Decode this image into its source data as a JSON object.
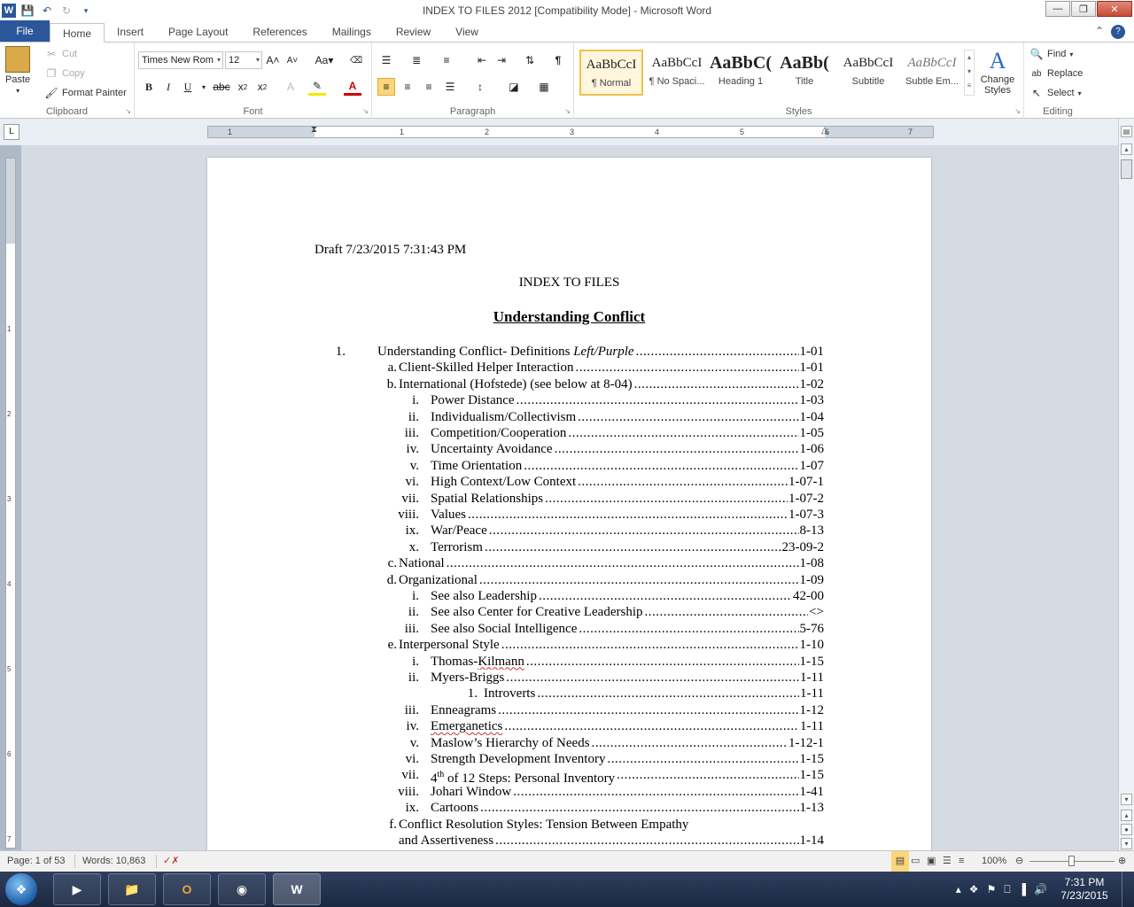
{
  "window": {
    "title": "INDEX TO FILES 2012 [Compatibility Mode]  -  Microsoft Word",
    "app_icon": "W",
    "minimize": "—",
    "maximize": "❐",
    "close": "✕"
  },
  "ribbon_tabs": [
    {
      "label": "File",
      "file": true
    },
    {
      "label": "Home",
      "active": true
    },
    {
      "label": "Insert"
    },
    {
      "label": "Page Layout"
    },
    {
      "label": "References"
    },
    {
      "label": "Mailings"
    },
    {
      "label": "Review"
    },
    {
      "label": "View"
    }
  ],
  "clipboard": {
    "paste": "Paste",
    "cut": "Cut",
    "copy": "Copy",
    "format_painter": "Format Painter",
    "label": "Clipboard"
  },
  "font": {
    "name": "Times New Rom",
    "size": "12",
    "label": "Font"
  },
  "paragraph": {
    "label": "Paragraph"
  },
  "styles": {
    "label": "Styles",
    "gallery": [
      {
        "sample": "AaBbCcI",
        "name": "¶ Normal",
        "selected": true
      },
      {
        "sample": "AaBbCcI",
        "name": "¶ No Spaci..."
      },
      {
        "sample": "AaBbC(",
        "name": "Heading 1",
        "bold": true
      },
      {
        "sample": "AaBb(",
        "name": "Title",
        "bold": true
      },
      {
        "sample": "AaBbCcI",
        "name": "Subtitle"
      },
      {
        "sample": "AaBbCcI",
        "name": "Subtle Em...",
        "italic": true
      }
    ],
    "change_styles": "Change Styles"
  },
  "editing": {
    "label": "Editing",
    "find": "Find",
    "replace": "Replace",
    "select": "Select"
  },
  "document": {
    "draft_line": "Draft 7/23/2015 7:31:43 PM",
    "title": "INDEX TO FILES",
    "heading": "Understanding Conflict",
    "toc": [
      {
        "level": 0,
        "num": "1.",
        "text": "Understanding Conflict- Definitions ",
        "italic_suffix": "Left/Purple",
        "page": "1-01"
      },
      {
        "level": 1,
        "num": "a.",
        "text": "Client-Skilled Helper Interaction",
        "page": "1-01"
      },
      {
        "level": 1,
        "num": "b.",
        "text": "International (Hofstede) (see below at 8-04)",
        "page": "1-02"
      },
      {
        "level": 2,
        "num": "i.",
        "text": "Power Distance",
        "page": "1-03"
      },
      {
        "level": 2,
        "num": "ii.",
        "text": "Individualism/Collectivism",
        "page": "1-04"
      },
      {
        "level": 2,
        "num": "iii.",
        "text": "Competition/Cooperation",
        "page": "1-05"
      },
      {
        "level": 2,
        "num": "iv.",
        "text": "Uncertainty Avoidance",
        "page": "1-06"
      },
      {
        "level": 2,
        "num": "v.",
        "text": "Time Orientation",
        "page": "1-07"
      },
      {
        "level": 2,
        "num": "vi.",
        "text": "High Context/Low Context",
        "page": "1-07-1"
      },
      {
        "level": 2,
        "num": "vii.",
        "text": "Spatial Relationships",
        "page": "1-07-2"
      },
      {
        "level": 2,
        "num": "viii.",
        "text": "Values",
        "page": "1-07-3"
      },
      {
        "level": 2,
        "num": "ix.",
        "text": "War/Peace",
        "page": "8-13"
      },
      {
        "level": 2,
        "num": "x.",
        "text": "Terrorism",
        "page": "23-09-2"
      },
      {
        "level": 1,
        "num": "c.",
        "text": "National",
        "page": "1-08"
      },
      {
        "level": 1,
        "num": "d.",
        "text": "Organizational",
        "page": "1-09"
      },
      {
        "level": 2,
        "num": "i.",
        "text": "See also Leadership",
        "page": "42-00"
      },
      {
        "level": 2,
        "num": "ii.",
        "text": "See also Center for Creative Leadership",
        "page": "<>"
      },
      {
        "level": 2,
        "num": "iii.",
        "text": "See also Social Intelligence",
        "page": "5-76"
      },
      {
        "level": 1,
        "num": "e.",
        "text": "Interpersonal Style",
        "page": "1-10"
      },
      {
        "level": 2,
        "num": "i.",
        "text": "Thomas-",
        "squiggle_suffix": "Kilmann",
        "page": "1-15"
      },
      {
        "level": 2,
        "num": "ii.",
        "text": "Myers-Briggs",
        "page": "1-11"
      },
      {
        "level": 3,
        "num": "1.",
        "text": "Introverts",
        "page": "1-11"
      },
      {
        "level": 2,
        "num": "iii.",
        "text": "Enneagrams",
        "page": "1-12"
      },
      {
        "level": 2,
        "num": "iv.",
        "text": "",
        "squiggle_suffix": "Emerganetics",
        "page": "1-11"
      },
      {
        "level": 2,
        "num": "v.",
        "text": "Maslow’s Hierarchy of Needs",
        "page": "1-12-1"
      },
      {
        "level": 2,
        "num": "vi.",
        "text": "Strength Development Inventory",
        "page": "1-15"
      },
      {
        "level": 2,
        "num": "vii.",
        "text": "4",
        "sup": "th",
        "text_after_sup": " of 12 Steps: Personal Inventory",
        "page": "1-15"
      },
      {
        "level": 2,
        "num": "viii.",
        "text": "Johari Window",
        "page": "1-41"
      },
      {
        "level": 2,
        "num": "ix.",
        "text": "Cartoons",
        "page": "1-13"
      },
      {
        "level": 1,
        "num": "f.",
        "text": "Conflict Resolution Styles: Tension  Between Empathy",
        "page": "",
        "no_leader": true
      },
      {
        "level": 1,
        "num": "",
        "text": "and Assertiveness",
        "page": "1-14"
      }
    ]
  },
  "statusbar": {
    "page": "Page: 1 of 53",
    "words": "Words: 10,863",
    "zoom": "100%"
  },
  "taskbar": {
    "time": "7:31 PM",
    "date": "7/23/2015"
  }
}
